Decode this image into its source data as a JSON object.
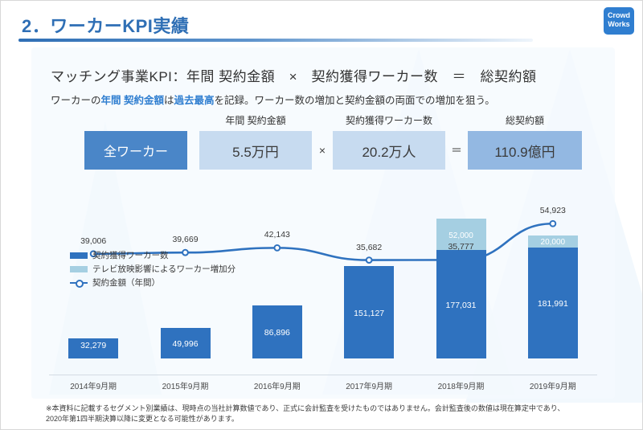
{
  "header": {
    "title": "2．ワーカーKPI実績",
    "logo_line1": "Crowd",
    "logo_line2": "Works",
    "accent_color": "#2f6fb5"
  },
  "body": {
    "formula": "マッチング事業KPI：年間 契約金額　×　契約獲得ワーカー数　＝　総契約額",
    "subtitle_pre": "ワーカーの",
    "subtitle_hi1": "年間 契約金額",
    "subtitle_mid": "は",
    "subtitle_hi2": "過去最高",
    "subtitle_post": "を記録。ワーカー数の増加と契約金額の両面での増加を狙う。"
  },
  "kpi": {
    "all_workers_label": "全ワーカー",
    "annual_amount_head": "年間 契約金額",
    "annual_amount_value": "5.5万円",
    "operator_multiply": "×",
    "workers_head": "契約獲得ワーカー数",
    "workers_value": "20.2万人",
    "operator_equals": "＝",
    "total_head": "総契約額",
    "total_value": "110.9億円",
    "color_all": "#4a86c8",
    "color_light": "#c7dbf0",
    "color_total": "#93b8e2"
  },
  "legend": {
    "items": [
      {
        "label": "契約獲得ワーカー数",
        "type": "bar",
        "color": "#2f72bf"
      },
      {
        "label": "テレビ放映影響によるワーカー増加分",
        "type": "bar",
        "color": "#a5cfe2"
      },
      {
        "label": "契約金額（年間）",
        "type": "line",
        "color": "#2f72bf"
      }
    ]
  },
  "footnote": {
    "line1": "※本資料に記載するセグメント別業績は、現時点の当社計算数値であり、正式に会計監査を受けたものではありません。会計監査後の数値は現在算定中であり、",
    "line2": "2020年第1四半期決算以降に変更となる可能性があります。"
  },
  "chart_data": {
    "type": "bar",
    "title": "",
    "xlabel": "",
    "ylabel": "",
    "categories": [
      "2014年9月期",
      "2015年9月期",
      "2016年9月期",
      "2017年9月期",
      "2018年9月期",
      "2019年9月期"
    ],
    "series": [
      {
        "name": "契約獲得ワーカー数",
        "type": "bar",
        "color": "#2f72bf",
        "values": [
          32279,
          49996,
          86896,
          151127,
          177031,
          181991
        ],
        "value_labels": [
          "32,279",
          "49,996",
          "86,896",
          "151,127",
          "177,031",
          "181,991"
        ]
      },
      {
        "name": "テレビ放映影響によるワーカー増加分",
        "type": "bar",
        "color": "#a5cfe2",
        "values": [
          0,
          0,
          0,
          0,
          52000,
          20000
        ],
        "value_labels": [
          "",
          "",
          "",
          "",
          "52,000",
          "20,000"
        ]
      },
      {
        "name": "契約金額（年間）",
        "type": "line",
        "color": "#2f72bf",
        "values": [
          39006,
          39669,
          42143,
          35682,
          35777,
          54923
        ],
        "value_labels": [
          "39,006",
          "39,669",
          "42,143",
          "35,682",
          "35,777",
          "54,923"
        ]
      }
    ],
    "bar_ylim": [
      0,
      250000
    ],
    "line_ylim": [
      0,
      60000
    ],
    "grid": false,
    "legend_position": "inside-left"
  }
}
